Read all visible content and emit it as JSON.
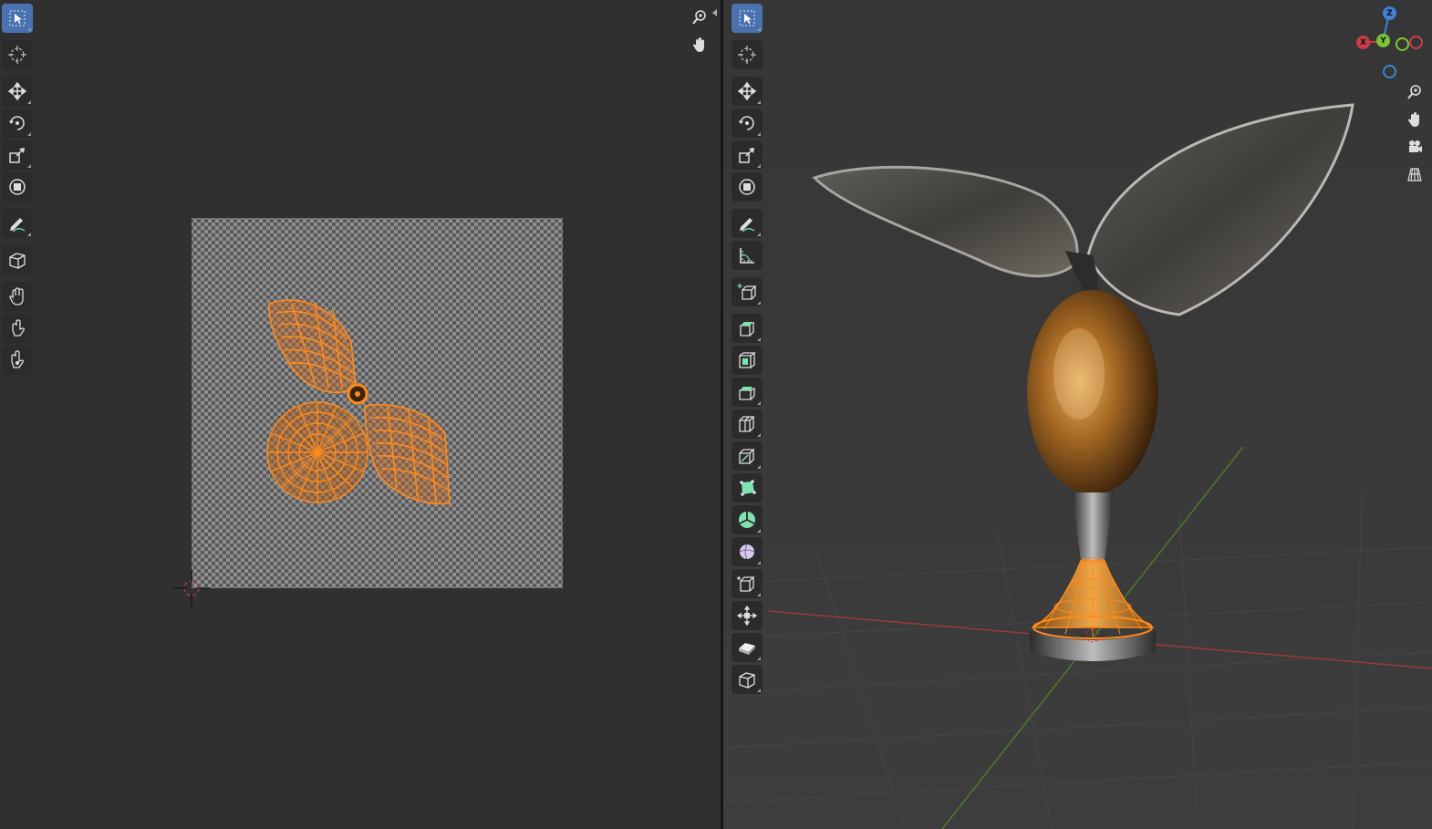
{
  "uv_editor": {
    "tools": [
      {
        "name": "select-box-tool",
        "icon": "cursor-icon",
        "active": true
      },
      {
        "name": "cursor-tool",
        "icon": "cursor-target-icon"
      },
      {
        "name": "move-tool",
        "icon": "move-icon"
      },
      {
        "name": "rotate-tool",
        "icon": "rotate-icon"
      },
      {
        "name": "scale-tool",
        "icon": "scale-icon"
      },
      {
        "name": "transform-tool",
        "icon": "transform-icon"
      },
      {
        "name": "annotate-tool",
        "icon": "annotate-icon"
      },
      {
        "name": "rip-tool",
        "icon": "rip-icon"
      },
      {
        "name": "grab-tool",
        "icon": "grab-hand-icon"
      },
      {
        "name": "relax-tool",
        "icon": "relax-icon"
      },
      {
        "name": "pinch-tool",
        "icon": "pinch-icon"
      }
    ],
    "nav": [
      "zoom-icon",
      "pan-hand-icon"
    ]
  },
  "viewport_3d": {
    "tools": [
      {
        "name": "select-box-tool",
        "icon": "cursor-icon",
        "active": true
      },
      {
        "name": "cursor-tool",
        "icon": "cursor-target-icon"
      },
      {
        "name": "move-tool",
        "icon": "move-icon"
      },
      {
        "name": "rotate-tool",
        "icon": "rotate-icon"
      },
      {
        "name": "scale-tool",
        "icon": "scale-icon"
      },
      {
        "name": "transform-tool",
        "icon": "transform-icon"
      },
      {
        "name": "annotate-tool",
        "icon": "annotate-icon"
      },
      {
        "name": "measure-tool",
        "icon": "measure-icon"
      },
      {
        "name": "add-cube-tool",
        "icon": "add-cube-icon"
      },
      {
        "name": "extrude-tool",
        "icon": "extrude-icon"
      },
      {
        "name": "inset-tool",
        "icon": "inset-icon"
      },
      {
        "name": "bevel-tool",
        "icon": "bevel-icon"
      },
      {
        "name": "loop-cut-tool",
        "icon": "loop-cut-icon"
      },
      {
        "name": "knife-tool",
        "icon": "knife-icon"
      },
      {
        "name": "poly-build-tool",
        "icon": "poly-build-icon"
      },
      {
        "name": "spin-tool",
        "icon": "spin-icon"
      },
      {
        "name": "smooth-tool",
        "icon": "smooth-icon"
      },
      {
        "name": "edge-slide-tool",
        "icon": "edge-slide-icon"
      },
      {
        "name": "shrink-fatten-tool",
        "icon": "shrink-fatten-icon"
      },
      {
        "name": "shear-tool",
        "icon": "shear-icon"
      },
      {
        "name": "rip-region-tool",
        "icon": "rip-region-icon"
      }
    ],
    "nav": [
      "zoom-icon",
      "pan-hand-icon",
      "camera-icon",
      "grid-icon"
    ],
    "gizmo": {
      "z": "Z",
      "y": "Y",
      "x": "X"
    }
  },
  "colors": {
    "accent": "#4a72b0",
    "uv_selection": "#ff8a1a",
    "axis_x": "#c83c4a",
    "axis_y": "#7cc53a",
    "axis_z": "#3f82d6",
    "gold": "#c8862a",
    "chrome": "#8a8a88"
  }
}
